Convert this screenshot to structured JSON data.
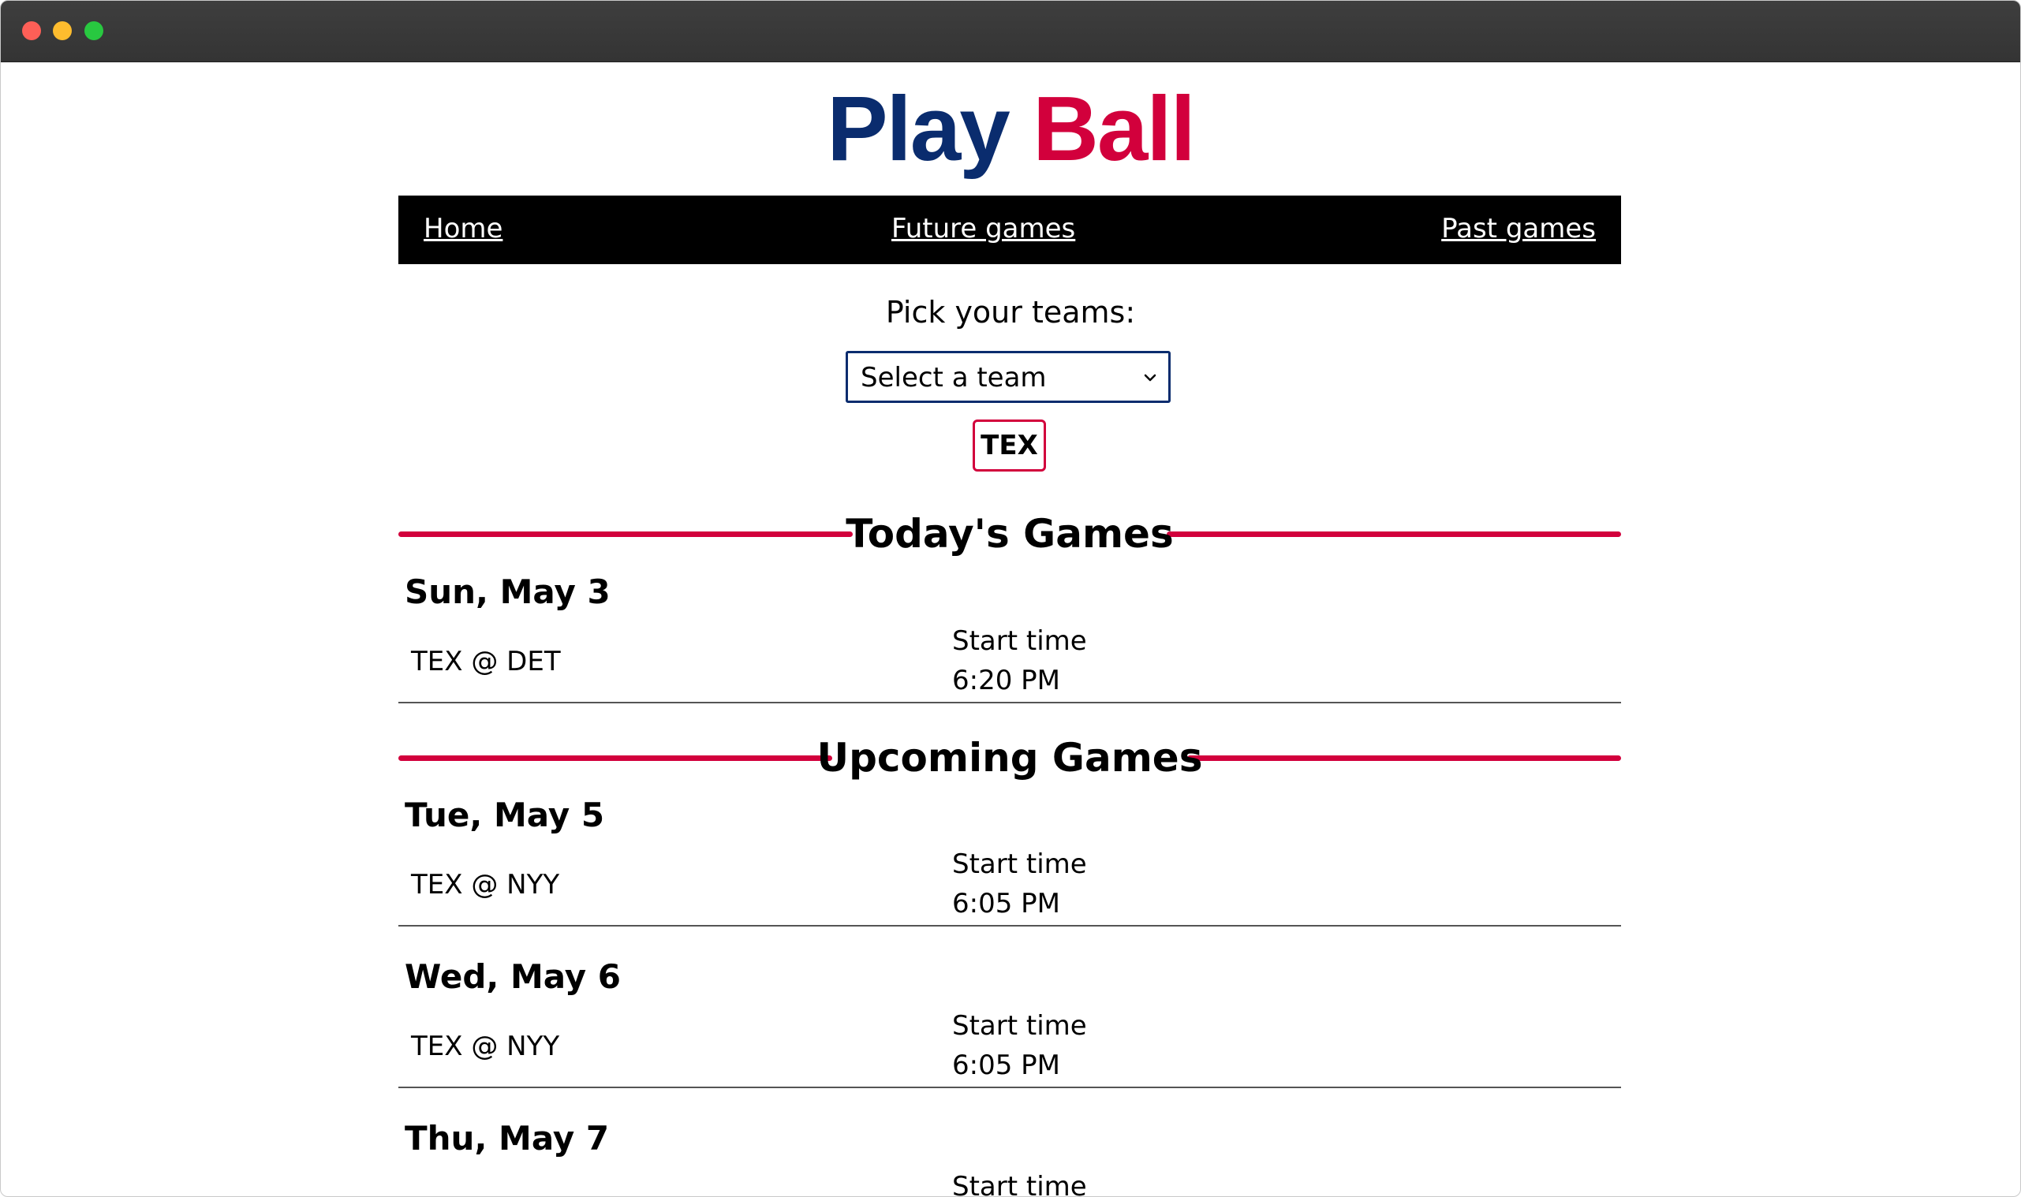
{
  "window": {
    "controls": [
      "close",
      "minimize",
      "zoom"
    ]
  },
  "logo": {
    "word1": "Play",
    "word2": "Ball"
  },
  "nav": {
    "home": "Home",
    "future": "Future games",
    "past": "Past games"
  },
  "picker": {
    "label": "Pick your teams:",
    "select_value": "Select a team",
    "chip": "TEX"
  },
  "sections": {
    "today": "Today's Games",
    "upcoming": "Upcoming Games"
  },
  "today_games": [
    {
      "date": "Sun, May 3",
      "matchup": "TEX @ DET",
      "start_label": "Start time",
      "start_time": "6:20 PM"
    }
  ],
  "upcoming_games": [
    {
      "date": "Tue, May 5",
      "matchup": "TEX @ NYY",
      "start_label": "Start time",
      "start_time": "6:05 PM"
    },
    {
      "date": "Wed, May 6",
      "matchup": "TEX @ NYY",
      "start_label": "Start time",
      "start_time": "6:05 PM"
    },
    {
      "date": "Thu, May 7",
      "start_label": "Start time"
    }
  ],
  "colors": {
    "brand_blue": "#0a2c6e",
    "brand_red": "#d2003c",
    "nav_bg": "#000000"
  }
}
